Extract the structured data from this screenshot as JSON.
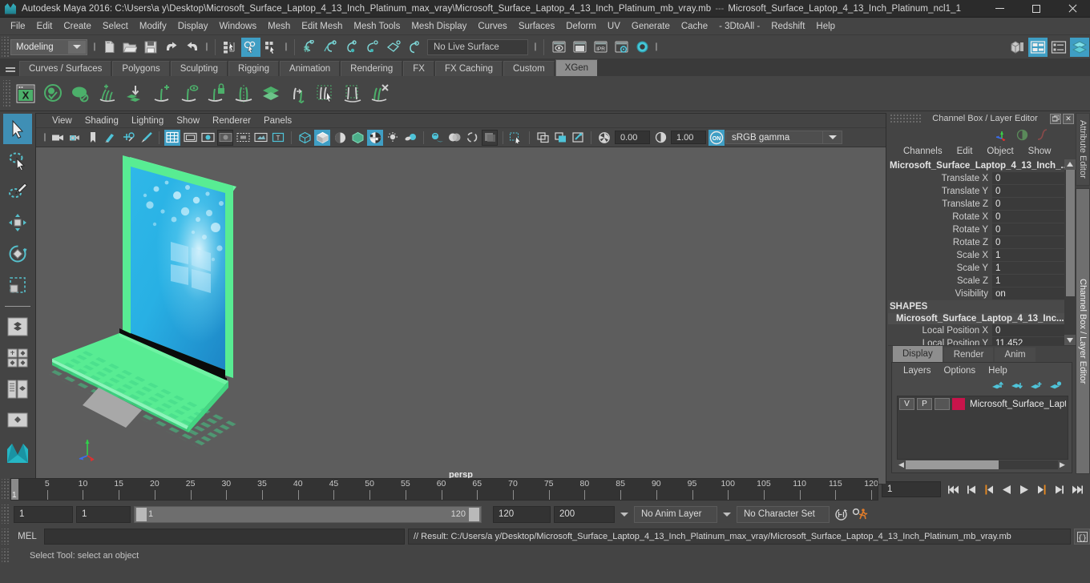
{
  "window": {
    "title": "Autodesk Maya 2016: C:\\Users\\a y\\Desktop\\Microsoft_Surface_Laptop_4_13_Inch_Platinum_max_vray\\Microsoft_Surface_Laptop_4_13_Inch_Platinum_mb_vray.mb",
    "separator": "---",
    "subtitle": "Microsoft_Surface_Laptop_4_13_Inch_Platinum_ncl1_1",
    "minimize": "minimize",
    "maximize": "restore",
    "close": "close"
  },
  "menubar": [
    "File",
    "Edit",
    "Create",
    "Select",
    "Modify",
    "Display",
    "Windows",
    "Mesh",
    "Edit Mesh",
    "Mesh Tools",
    "Mesh Display",
    "Curves",
    "Surfaces",
    "Deform",
    "UV",
    "Generate",
    "Cache",
    "- 3DtoAll -",
    "Redshift",
    "Help"
  ],
  "statusline": {
    "mode": "Modeling",
    "live_surface": "No Live Surface",
    "file_icons": [
      "new-scene-icon",
      "open-scene-icon",
      "save-scene-icon",
      "undo-icon",
      "redo-icon"
    ],
    "select_mode_icons": [
      "select-by-hierarchy-icon",
      "select-by-object-type-icon",
      "select-by-component-type-icon"
    ],
    "snap_icons": [
      "snap-to-grid-icon",
      "snap-to-curve-icon",
      "snap-to-point-icon",
      "snap-to-projected-center-icon",
      "snap-to-view-plane-icon",
      "make-live-icon"
    ],
    "render_icons": [
      "render-current-frame-icon",
      "render-sequence-icon",
      "ipr-render-icon",
      "render-settings-icon",
      "hypershade-icon"
    ],
    "right_icons": [
      "show-hide-modeling-toolkit-icon",
      "show-hide-attribute-editor-icon",
      "show-hide-tool-settings-icon",
      "show-hide-channel-box-icon"
    ]
  },
  "shelf": {
    "tabs": [
      "Curves / Surfaces",
      "Polygons",
      "Sculpting",
      "Rigging",
      "Animation",
      "Rendering",
      "FX",
      "FX Caching",
      "Custom",
      "XGen"
    ],
    "active_tab": "XGen",
    "icons": [
      "xgen-window-icon",
      "xgen-preview-icon",
      "xgen-disable-preview-icon",
      "xgen-add-groom-icon",
      "xgen-import-collection-icon",
      "xgen-add-guide-icon",
      "xgen-preview-guide-icon",
      "xgen-lock-guide-icon",
      "xgen-mirror-guide-icon",
      "xgen-layer-icon",
      "xgen-length-tool-icon",
      "xgen-select-guide-icon",
      "xgen-region-tool-icon",
      "xgen-delete-guide-icon"
    ]
  },
  "toolbox": {
    "tools": [
      {
        "name": "select-tool",
        "selected": true
      },
      {
        "name": "lasso-select-tool",
        "selected": false
      },
      {
        "name": "paint-select-tool",
        "selected": false
      },
      {
        "name": "move-tool",
        "selected": false
      },
      {
        "name": "rotate-tool",
        "selected": false
      },
      {
        "name": "scale-tool",
        "selected": false
      }
    ],
    "layouts": [
      "single-perspective-layout-icon",
      "four-view-layout-icon",
      "outliner-persp-layout-icon",
      "persp-graph-layout-icon",
      "maya-logo-icon"
    ]
  },
  "viewport": {
    "menus": [
      "View",
      "Shading",
      "Lighting",
      "Show",
      "Renderer",
      "Panels"
    ],
    "camera_label": "persp",
    "exposure": "0.00",
    "gamma": "1.00",
    "color_mgmt": "sRGB gamma",
    "color_mgmt_toggle": "ON",
    "toolbar_icons": [
      "select-camera-icon",
      "camera-attributes-icon",
      "bookmark-icon",
      "image-plane-icon",
      "2d-pan-zoom-icon",
      "grease-pencil-icon",
      "grid-toggle-icon",
      "film-gate-icon",
      "resolution-gate-icon",
      "gate-mask-icon",
      "film-origin-icon",
      "safe-action-icon",
      "safe-title-icon",
      "wireframe-icon",
      "smooth-shade-all-icon",
      "smooth-shade-selected-icon",
      "flat-shade-icon",
      "shaded-wireframe-icon",
      "textured-icon",
      "use-default-lighting-icon",
      "use-all-lights-icon",
      "shadows-icon",
      "screen-space-ao-icon",
      "motion-blur-icon",
      "multisample-aa-icon",
      "isolate-select-icon",
      "xray-icon",
      "xray-joints-icon",
      "xray-active-components-icon",
      "exposure-icon",
      "gamma-icon"
    ],
    "colors": {
      "background": "#5d5d5d",
      "selection_green": "#58ec93",
      "screen_blue": "#2ab7e8"
    }
  },
  "channel_box": {
    "panel_title": "Channel Box / Layer Editor",
    "menus": [
      "Channels",
      "Edit",
      "Object",
      "Show"
    ],
    "object_name": "Microsoft_Surface_Laptop_4_13_Inch_...",
    "attributes": [
      {
        "label": "Translate X",
        "value": "0"
      },
      {
        "label": "Translate Y",
        "value": "0"
      },
      {
        "label": "Translate Z",
        "value": "0"
      },
      {
        "label": "Rotate X",
        "value": "0"
      },
      {
        "label": "Rotate Y",
        "value": "0"
      },
      {
        "label": "Rotate Z",
        "value": "0"
      },
      {
        "label": "Scale X",
        "value": "1"
      },
      {
        "label": "Scale Y",
        "value": "1"
      },
      {
        "label": "Scale Z",
        "value": "1"
      },
      {
        "label": "Visibility",
        "value": "on"
      }
    ],
    "shapes_header": "SHAPES",
    "shape_name": "Microsoft_Surface_Laptop_4_13_Inc...",
    "shape_attributes": [
      {
        "label": "Local Position X",
        "value": "0"
      },
      {
        "label": "Local Position Y",
        "value": "11.452"
      }
    ]
  },
  "layer_editor": {
    "tabs": [
      "Display",
      "Render",
      "Anim"
    ],
    "active_tab": "Display",
    "menus": [
      "Layers",
      "Options",
      "Help"
    ],
    "toolbar_icons": [
      "move-layer-up-icon",
      "move-layer-down-icon",
      "new-layer-icon",
      "new-layer-from-selected-icon"
    ],
    "layers": [
      {
        "visibility": "V",
        "playback": "P",
        "shading": "",
        "color": "#c8144b",
        "name": "Microsoft_Surface_Lapto"
      }
    ]
  },
  "right_tabs": [
    {
      "label": "Attribute Editor",
      "active": false
    },
    {
      "label": "Channel Box / Layer Editor",
      "active": true
    }
  ],
  "timeline": {
    "start": 1,
    "end": 120,
    "tick_step": 5,
    "ticks": [
      5,
      10,
      15,
      20,
      25,
      30,
      35,
      40,
      45,
      50,
      55,
      60,
      65,
      70,
      75,
      80,
      85,
      90,
      95,
      100,
      105,
      110,
      115,
      120
    ],
    "current_frame_marker": "1",
    "current_frame": "1",
    "playback_buttons": [
      "go-to-start-icon",
      "step-back-keyframe-icon",
      "step-back-frame-icon",
      "play-backwards-icon",
      "play-forwards-icon",
      "step-forward-frame-icon",
      "step-forward-keyframe-icon",
      "go-to-end-icon"
    ]
  },
  "range": {
    "anim_start": "1",
    "range_start": "1",
    "bar_start": "1",
    "bar_end": "120",
    "range_end": "120",
    "anim_end": "200",
    "anim_layer": "No Anim Layer",
    "character_set": "No Character Set",
    "auto_key_icon": "auto-keyframe-icon",
    "anim_prefs_icon": "animation-preferences-icon"
  },
  "command_line": {
    "language": "MEL",
    "input_value": "",
    "result": "// Result: C:/Users/a y/Desktop/Microsoft_Surface_Laptop_4_13_Inch_Platinum_max_vray/Microsoft_Surface_Laptop_4_13_Inch_Platinum_mb_vray.mb",
    "script_editor_icon": "script-editor-icon"
  },
  "help_line": {
    "text": "Select Tool: select an object"
  }
}
